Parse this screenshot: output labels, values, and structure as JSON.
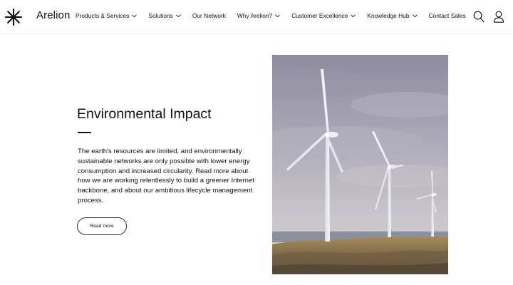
{
  "header": {
    "brand": "Arelion",
    "nav": [
      {
        "label": "Products & Services",
        "dropdown": true
      },
      {
        "label": "Solutions",
        "dropdown": true
      },
      {
        "label": "Our Network",
        "dropdown": false
      },
      {
        "label": "Why Arelion?",
        "dropdown": true
      },
      {
        "label": "Customer Excellence",
        "dropdown": true
      },
      {
        "label": "Knowledge Hub",
        "dropdown": true
      },
      {
        "label": "Contact Sales",
        "dropdown": false
      }
    ],
    "icons": [
      "search-icon",
      "user-icon"
    ]
  },
  "main": {
    "title": "Environmental Impact",
    "body": "The earth's resources are limited, and environmentally sustainable networks are only possible with lower energy consumption and increased circularity. Read more about how we are working relentlessly to build a greener Internet backbone, and about our ambitious lifecycle management process.",
    "cta_label": "Read more",
    "image_icon": "wind-turbines-photo"
  },
  "colors": {
    "text": "#111111",
    "background": "#ffffff",
    "divider": "#ececec"
  }
}
